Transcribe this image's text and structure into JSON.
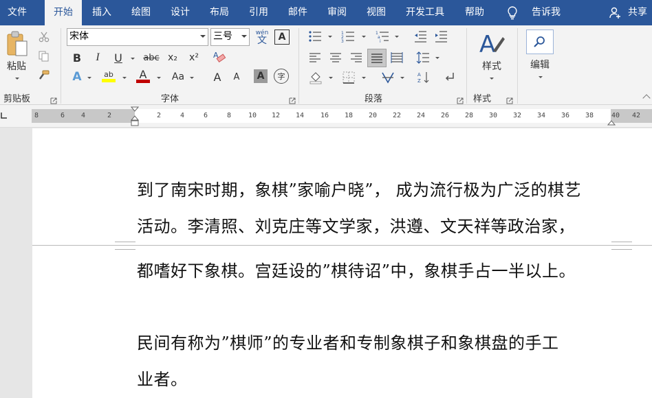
{
  "tabs": [
    {
      "label": "文件"
    },
    {
      "label": "开始"
    },
    {
      "label": "插入"
    },
    {
      "label": "绘图"
    },
    {
      "label": "设计"
    },
    {
      "label": "布局"
    },
    {
      "label": "引用"
    },
    {
      "label": "邮件"
    },
    {
      "label": "审阅"
    },
    {
      "label": "视图"
    },
    {
      "label": "开发工具"
    },
    {
      "label": "帮助"
    }
  ],
  "tell_me": "告诉我",
  "share": "共享",
  "ribbon": {
    "clipboard": {
      "paste_label": "粘贴",
      "group_label": "剪贴板"
    },
    "font": {
      "name": "宋体",
      "size": "三号",
      "group_label": "字体",
      "bold": "B",
      "italic": "I",
      "underline": "U",
      "strike": "abc",
      "subscript": "x₂",
      "superscript": "x²",
      "change_case": "Aa",
      "grow": "A",
      "shrink": "A",
      "char_shading": "A",
      "phonetic_top": "wén",
      "phonetic_bottom": "文",
      "char_border": "A",
      "font_color": "A",
      "text_effects": "A",
      "highlight": "ab",
      "enclose": "字"
    },
    "paragraph": {
      "group_label": "段落"
    },
    "styles": {
      "label": "样式",
      "group_label": "样式"
    },
    "editing": {
      "label": "编辑"
    }
  },
  "ruler": {
    "ticks": [
      "8",
      "6",
      "4",
      "2",
      "2",
      "4",
      "6",
      "8",
      "10",
      "12",
      "14",
      "16",
      "18",
      "20",
      "22",
      "24",
      "26",
      "28",
      "30",
      "32",
      "34",
      "36",
      "38",
      "40",
      "42"
    ]
  },
  "document": {
    "lines": [
      "到了南宋时期，象棋”家喻户晓”， 成为流行极为广泛的棋艺",
      "活动。李清照、刘克庄等文学家，洪遵、文天祥等政治家，",
      "都嗜好下象棋。宫廷设的”棋待诏”中，象棋手占一半以上。",
      "民间有称为”棋师”的专业者和专制象棋子和象棋盘的手工",
      "业者。"
    ]
  },
  "colors": {
    "accent": "#2b579a",
    "ribbon_bg": "#f3f3f3",
    "font_color_bar": "#c00000",
    "highlight_bar": "#ffff00"
  }
}
